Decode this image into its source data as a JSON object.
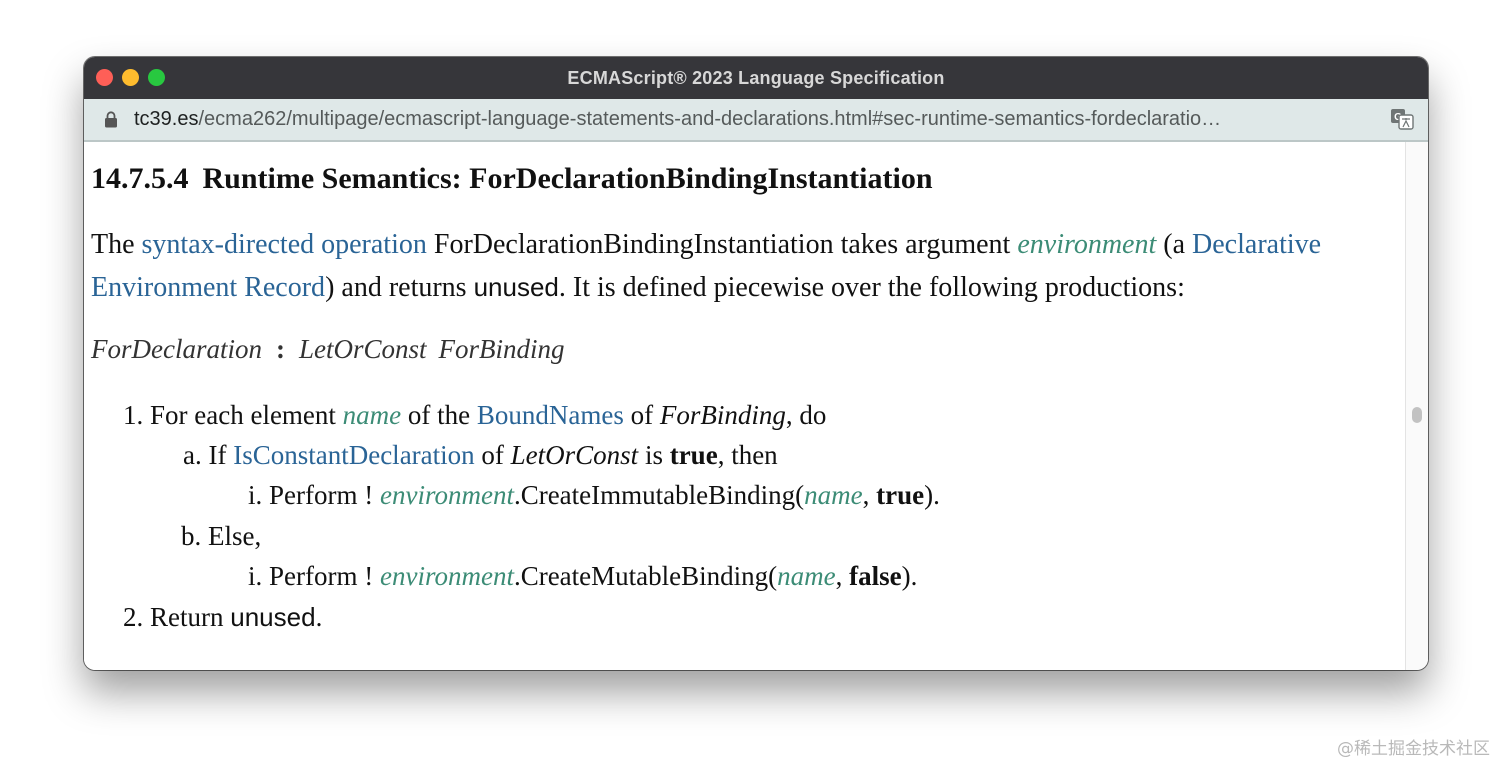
{
  "window": {
    "title": "ECMAScript® 2023 Language Specification",
    "controls": [
      "close",
      "minimize",
      "zoom"
    ],
    "control_colors": {
      "close": "#fe5f57",
      "minimize": "#febc2e",
      "zoom": "#28c840"
    }
  },
  "urlbar": {
    "lock_icon": "lock-icon",
    "domain": "tc39.es",
    "path": "/ecma262/multipage/ecmascript-language-statements-and-declarations.html#sec-runtime-semantics-fordeclaratio…",
    "translate_icon": "translate-icon"
  },
  "page": {
    "heading": {
      "number": "14.7.5.4",
      "title": "Runtime Semantics: ForDeclarationBindingInstantiation"
    },
    "intro": {
      "t1": "The ",
      "link1": "syntax-directed operation",
      "t2": " ForDeclarationBindingInstantiation takes argument ",
      "arg": "environment",
      "t3": " (a ",
      "link2": "Declarative Environment Record",
      "t4": ") and returns ",
      "ret": "unused",
      "t5": ". It is defined piecewise over the following productions:"
    },
    "production": {
      "lhs": "ForDeclaration",
      "colon": ":",
      "rhs1": "LetOrConst",
      "rhs2": "ForBinding"
    },
    "steps": {
      "s1": {
        "marker": "1.",
        "t1": "For each element ",
        "var": "name",
        "t2": " of the ",
        "link": "BoundNames",
        "t3": " of ",
        "nt": "ForBinding",
        "t4": ", do"
      },
      "s1a": {
        "marker": "a.",
        "t1": "If ",
        "link": "IsConstantDeclaration",
        "t2": " of ",
        "nt": "LetOrConst",
        "t3": " is ",
        "bool": "true",
        "t4": ", then"
      },
      "s1ai": {
        "marker": "i.",
        "t1": "Perform ! ",
        "var1": "environment",
        "t2": ".CreateImmutableBinding(",
        "var2": "name",
        "t3": ", ",
        "bool": "true",
        "t4": ")."
      },
      "s1b": {
        "marker": "b.",
        "t1": "Else,"
      },
      "s1bi": {
        "marker": "i.",
        "t1": "Perform ! ",
        "var1": "environment",
        "t2": ".CreateMutableBinding(",
        "var2": "name",
        "t3": ", ",
        "bool": "false",
        "t4": ")."
      },
      "s2": {
        "marker": "2.",
        "t1": "Return ",
        "val": "unused",
        "t2": "."
      }
    }
  },
  "watermark": "@稀土掘金技术社区",
  "colors": {
    "link": "#2a6496",
    "variable": "#3c8c76",
    "titlebar": "#36363a",
    "urlbar": "#dfe8e8"
  }
}
